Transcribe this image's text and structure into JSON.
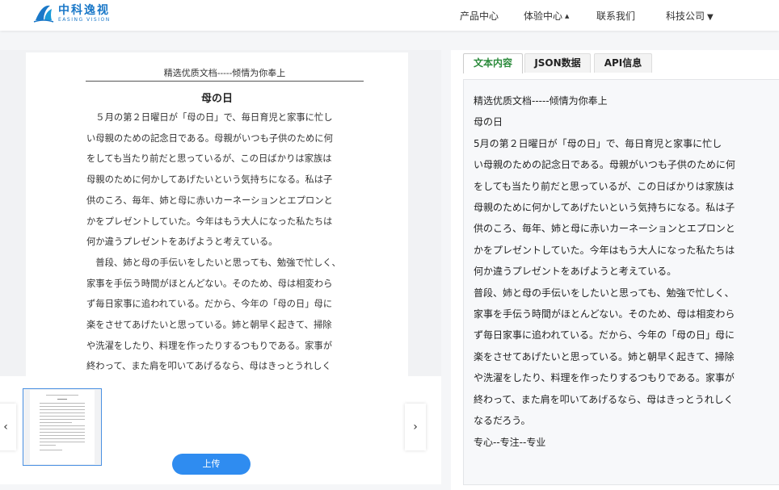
{
  "header": {
    "logo_cn": "中科逸视",
    "logo_en": "EASING VISION",
    "nav": [
      {
        "label": "产品中心"
      },
      {
        "label": "体验中心"
      },
      {
        "label": "联系我们"
      },
      {
        "label": "科技公司"
      }
    ]
  },
  "document": {
    "header": "精选优质文档-----倾情为你奉上",
    "title": "母の日",
    "lines": [
      "　５月の第２日曜日が「母の日」で、毎日育児と家事に忙し",
      "い母親のための記念日である。母親がいつも子供のために何",
      "をしても当たり前だと思っているが、この日ばかりは家族は",
      "母親のために何かしてあげたいという気持ちになる。私は子",
      "供のころ、毎年、姉と母に赤いカーネーションとエプロンと",
      "かをプレゼントしていた。今年はもう大人になった私たちは",
      "何か違うプレゼントをあげようと考えている。",
      "　普段、姉と母の手伝いをしたいと思っても、勉強で忙しく、",
      "家事を手伝う時間がほとんどない。そのため、母は相変わら",
      "ず毎日家事に追われている。だから、今年の「母の日」母に",
      "楽をさせてあげたいと思っている。姉と朝早く起きて、掃除",
      "や洗濯をしたり、料理を作ったりするつもりである。家事が",
      "終わって、また肩を叩いてあげるなら、母はきっとうれしく"
    ]
  },
  "thumbnails": {
    "prev_arrow": "‹",
    "next_arrow": "›"
  },
  "upload_label": "上传",
  "tabs": [
    {
      "label": "文本内容",
      "active": true
    },
    {
      "label": "JSON数据",
      "active": false
    },
    {
      "label": "API信息",
      "active": false
    }
  ],
  "result_lines": [
    "精选优质文档-----倾情为你奉上",
    "母の日",
    "5月の第２日曜日が「母の日」で、毎日育児と家事に忙し",
    "い母親のための記念日である。母親がいつも子供のために何",
    "をしても当たり前だと思っているが、この日ばかりは家族は",
    "母親のために何かしてあげたいという気持ちになる。私は子",
    "供のころ、毎年、姉と母に赤いカーネーションとエプロンと",
    "かをプレゼントしていた。今年はもう大人になった私たちは",
    "何か違うプレゼントをあげようと考えている。",
    "普段、姉と母の手伝いをしたいと思っても、勉強で忙しく、",
    "家事を手伝う時間がほとんどない。そのため、母は相変わら",
    "ず毎日家事に追われている。だから、今年の「母の日」母に",
    "楽をさせてあげたいと思っている。姉と朝早く起きて、掃除",
    "や洗濯をしたり、料理を作ったりするつもりである。家事が",
    "終わって、また肩を叩いてあげるなら、母はきっとうれしく",
    "なるだろう。",
    "专心--专注--专业"
  ],
  "colors": {
    "brand": "#1a78c8",
    "upload_button": "#2f8cf0",
    "active_tab_text": "#2a8a3a",
    "thumb_border": "#4a90e2"
  }
}
